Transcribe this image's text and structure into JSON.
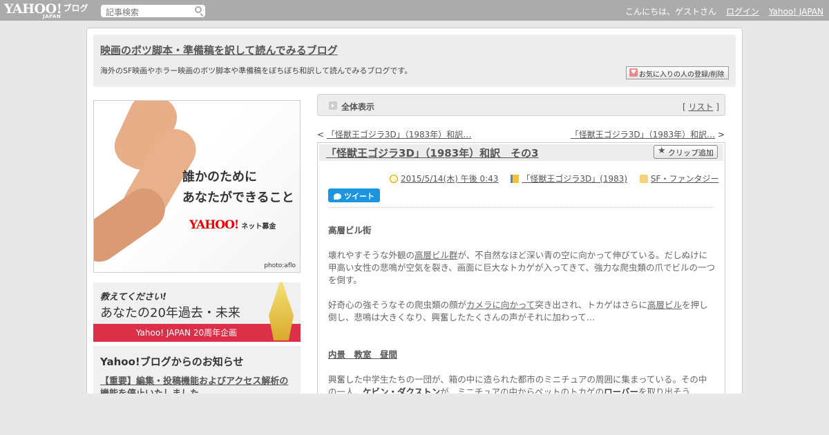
{
  "topbar": {
    "logo_main": "YAHOO!",
    "logo_sub": "JAPAN",
    "logo_blog": "ブログ",
    "search_placeholder": "記事検索",
    "greeting": "こんにちは、ゲストさん",
    "login": "ログイン",
    "yahoo_japan": "Yahoo! JAPAN"
  },
  "blog": {
    "title": "映画のボツ脚本・準備稿を訳して読んでみるブログ",
    "description": "海外のSF映画やホラー映画のボツ脚本や準備稿をぼちぼち和訳して読んでみるブログです。",
    "fav_button": "お気に入りの人の登録/削除"
  },
  "sidebar": {
    "banner1": {
      "line1": "誰かのために",
      "line2": "あなたができること",
      "logo": "YAHOO!",
      "logo_sub": "ネット募金",
      "credit": "photo:aflo"
    },
    "banner2": {
      "line1": "教えてください!",
      "line2": "あなたの20年過去・未来",
      "stripe": "Yahoo! JAPAN 20周年企画"
    },
    "notice": {
      "heading": "Yahoo!ブログからのお知らせ",
      "link": "【重要】編集・投稿機能およびアクセス解析の機能を停止いたしました"
    }
  },
  "viewbar": {
    "label": "全体表示",
    "list_open": "[ ",
    "list_link": "リスト",
    "list_close": " ]"
  },
  "nav": {
    "prev_arrow": "< ",
    "prev": "「怪獣王ゴジラ3D」（1983年）和訳…",
    "next": "「怪獣王ゴジラ3D」（1983年）和訳…",
    "next_arrow": " >"
  },
  "article": {
    "title": "「怪獣王ゴジラ3D」（1983年）和訳　その3",
    "clip_button": "クリップ追加",
    "date": "2015/5/14(木) 午後 0:43",
    "book": "「怪獣王ゴジラ3D」(1983)",
    "category": "SF・ファンタジー",
    "tweet": "ツイート",
    "heading1": "高層ビル街",
    "p1a": "壊れやすそうな外観の",
    "p1b": "高層ビル群",
    "p1c": "が、不自然なほど深い青の空に向かって伸びている。だしぬけに甲高い女性の悲鳴が空気を裂き、画面に巨大なトカゲが入ってきて、強力な爬虫類の爪でビルの一つを倒す。",
    "p2a": "好奇心の強そうなその爬虫類の顔が",
    "p2b": "カメラに向かって",
    "p2c": "突き出され、トカゲはさらに",
    "p2d": "高層ビル",
    "p2e": "を押し倒し、悲鳴は大きくなり、興奮したたくさんの声がそれに加わって…",
    "heading2": "内景　教室　昼間",
    "p3a": "興奮した中学生たちの一団が、箱の中に造られた都市のミニチュアの周囲に集まっている。その中の一人、",
    "p3b": "ケビン・ダクストン",
    "p3c": "が、ミニチュアの中からペットのトカゲの",
    "p3d": "ローバー",
    "p3e": "を取り出そう"
  }
}
